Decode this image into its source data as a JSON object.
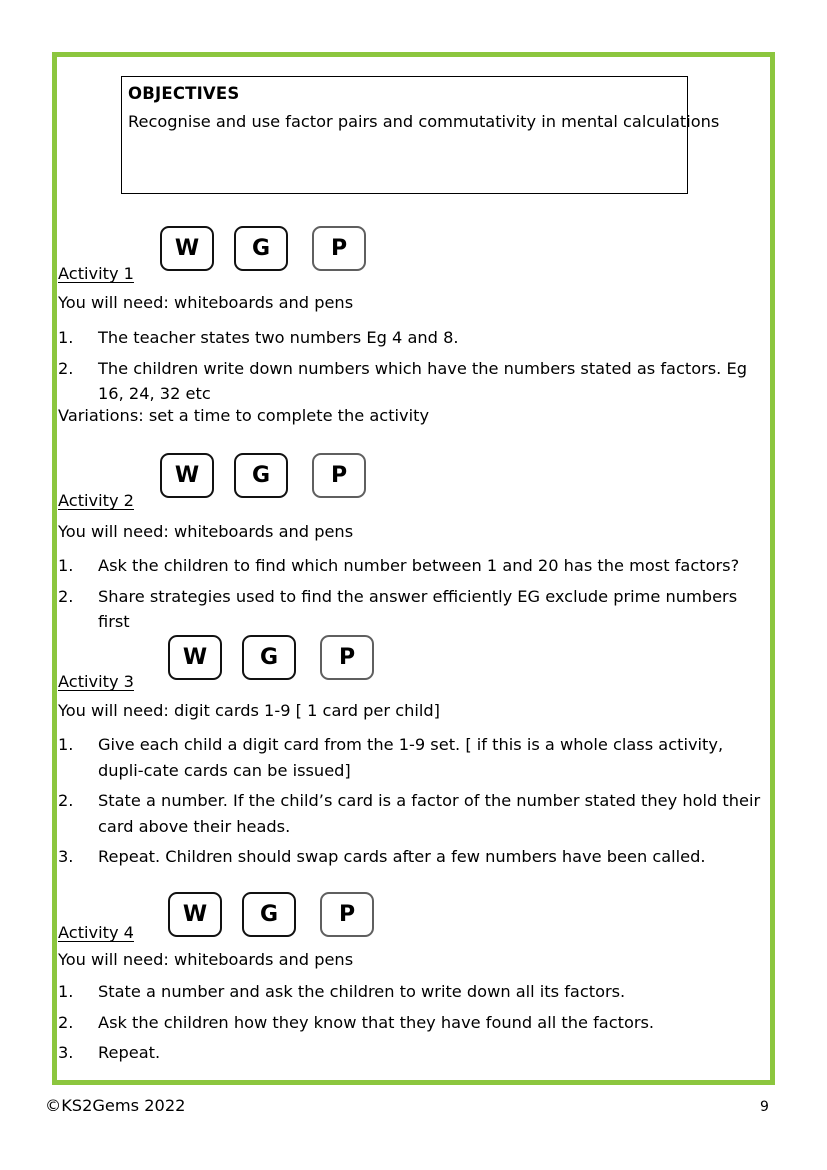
{
  "page": {
    "objectives": {
      "heading": "OBJECTIVES",
      "text": "Recognise and use factor pairs and commutativity in mental calculations"
    },
    "badge_labels": {
      "whole_class": "W",
      "group": "G",
      "paired": "P"
    },
    "activities": [
      {
        "label": "Activity 1",
        "resources": "You will need: whiteboards and pens",
        "steps": [
          {
            "num": "1.",
            "text": "The teacher states two numbers Eg 4 and 8."
          },
          {
            "num": "2.",
            "text": "The children write down numbers which have the numbers stated as factors. Eg 16, 24, 32 etc"
          }
        ],
        "note": "Variations: set a time to complete the activity"
      },
      {
        "label": "Activity 2",
        "resources": "You will need: whiteboards and pens",
        "steps": [
          {
            "num": "1.",
            "text": "Ask the children to find which number between 1 and 20 has the most factors?"
          },
          {
            "num": "2.",
            "text": "Share strategies used to find the answer efficiently EG exclude prime  numbers first"
          }
        ],
        "note": ""
      },
      {
        "label": "Activity 3",
        "resources": "You will need: digit cards 1-9 [ 1 card per child]",
        "steps": [
          {
            "num": "1.",
            "text": "Give each child a digit card from the 1-9 set. [ if this is a whole class activity, dupli-cate cards can be issued]"
          },
          {
            "num": "2.",
            "text": "State a number. If the child’s card is a factor of the number stated they hold their card above their heads."
          },
          {
            "num": "3.",
            "text": "Repeat. Children should swap cards after a few numbers have been called."
          }
        ],
        "note": ""
      },
      {
        "label": "Activity 4",
        "resources": "You will need: whiteboards and pens",
        "steps": [
          {
            "num": "1.",
            "text": "State a number and ask the children to write down all its factors."
          },
          {
            "num": "2.",
            "text": "Ask the children how they know that they have found all the factors."
          },
          {
            "num": "3.",
            "text": "Repeat."
          }
        ],
        "note": ""
      }
    ],
    "footer": {
      "copyright": "©KS2Gems 2022",
      "page_number": "9"
    },
    "colors": {
      "frame_green": "#8CC63E",
      "text_black": "#000000"
    }
  }
}
